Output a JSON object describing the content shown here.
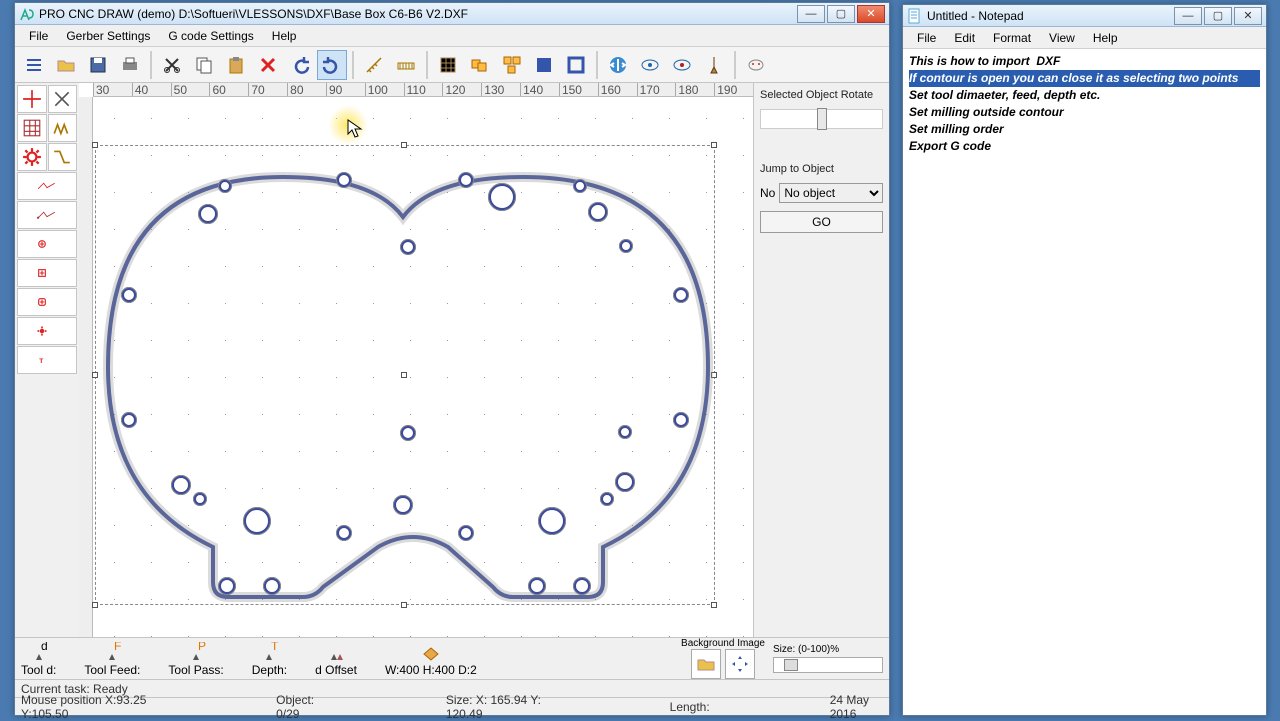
{
  "main_window": {
    "title": "PRO CNC DRAW (demo) D:\\Softueri\\VLESSONS\\DXF\\Base Box C6-B6 V2.DXF",
    "menus": [
      "File",
      "Gerber Settings",
      "G code Settings",
      "Help"
    ],
    "right_panel": {
      "rotate_label": "Selected Object Rotate",
      "jump_label": "Jump to Object",
      "jump_row_label": "No",
      "jump_options": [
        "No object"
      ],
      "jump_selected": "No object",
      "go_label": "GO"
    },
    "ruler_h": [
      "30",
      "40",
      "50",
      "60",
      "70",
      "80",
      "90",
      "100",
      "110",
      "120",
      "130",
      "140",
      "150",
      "160",
      "170",
      "180",
      "190"
    ],
    "bottom": {
      "tool_d": "Tool d:",
      "tool_feed": "Tool Feed:",
      "tool_pass": "Tool Pass:",
      "depth": "Depth:",
      "d_offset": "d Offset",
      "whd": "W:400 H:400 D:2",
      "bg_label": "Background Image",
      "size_label": "Size: (0-100)%"
    },
    "status1": "Current task: Ready",
    "status2": {
      "mouse": "Mouse position X:93.25 Y:105.50",
      "object": "Object: 0/29",
      "size": "Size: X: 165.94 Y: 120.49",
      "length": "Length:",
      "date": "24 May 2016"
    }
  },
  "notepad": {
    "title": "Untitled - Notepad",
    "menus": [
      "File",
      "Edit",
      "Format",
      "View",
      "Help"
    ],
    "lines": [
      "This is how to import  DXF",
      "If contour is open you can close it as selecting two points",
      "Set tool dimaeter, feed, depth etc.",
      "Set milling outside contour",
      "Set milling order",
      "Export G code"
    ],
    "selected_line_index": 1
  },
  "toolbar_icons": [
    "list",
    "open",
    "save",
    "print",
    "cut",
    "copy",
    "paste",
    "delete",
    "undo",
    "redo",
    "ruler1",
    "ruler2",
    "grid",
    "grp1",
    "grp2",
    "fill1",
    "fill2",
    "arrow-split",
    "eye1",
    "eye2",
    "tool",
    "head"
  ],
  "left_icons": [
    "crosshair",
    "snap",
    "grid2",
    "zigzag",
    "gear",
    "zigzag2",
    "trace",
    "circle-plus",
    "rect-plus",
    "rect-plus2",
    "gear-red",
    "text"
  ]
}
